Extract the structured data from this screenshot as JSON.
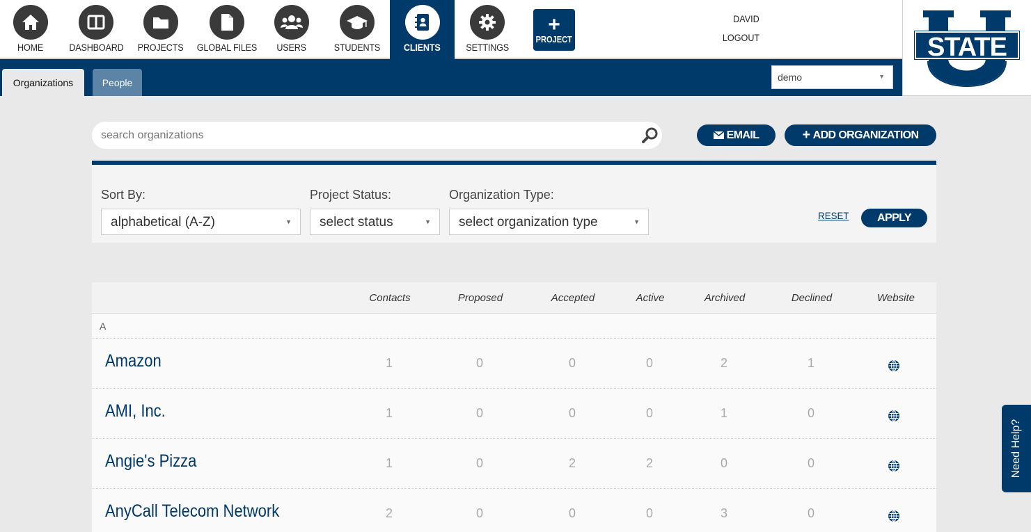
{
  "nav": {
    "items": [
      {
        "label": "HOME",
        "icon": "home-icon"
      },
      {
        "label": "DASHBOARD",
        "icon": "dashboard-icon"
      },
      {
        "label": "PROJECTS",
        "icon": "folder-icon"
      },
      {
        "label": "GLOBAL FILES",
        "icon": "file-icon"
      },
      {
        "label": "USERS",
        "icon": "users-icon"
      },
      {
        "label": "STUDENTS",
        "icon": "graduation-cap-icon"
      },
      {
        "label": "CLIENTS",
        "icon": "contact-book-icon",
        "active": true
      },
      {
        "label": "SETTINGS",
        "icon": "gear-icon"
      }
    ],
    "project_button": "PROJECT",
    "user_name": "DAVID",
    "logout": "LOGOUT"
  },
  "logo": {
    "text": "STATE"
  },
  "tabs": {
    "organizations": "Organizations",
    "people": "People",
    "site_select": "demo"
  },
  "search": {
    "placeholder": "search organizations"
  },
  "actions": {
    "email": "EMAIL",
    "add_organization": "ADD ORGANIZATION"
  },
  "filters": {
    "sort_label": "Sort By:",
    "sort_value": "alphabetical (A-Z)",
    "status_label": "Project Status:",
    "status_value": "select status",
    "type_label": "Organization Type:",
    "type_value": "select organization type",
    "reset": "RESET",
    "apply": "APPLY"
  },
  "table": {
    "columns": [
      "Contacts",
      "Proposed",
      "Accepted",
      "Active",
      "Archived",
      "Declined",
      "Website"
    ],
    "section_letter": "A",
    "rows": [
      {
        "name": "Amazon",
        "contacts": "1",
        "proposed": "0",
        "accepted": "0",
        "active": "0",
        "archived": "2",
        "declined": "1"
      },
      {
        "name": "AMI, Inc.",
        "contacts": "1",
        "proposed": "0",
        "accepted": "0",
        "active": "0",
        "archived": "1",
        "declined": "0"
      },
      {
        "name": "Angie's Pizza",
        "contacts": "1",
        "proposed": "0",
        "accepted": "2",
        "active": "2",
        "archived": "0",
        "declined": "0"
      },
      {
        "name": "AnyCall Telecom Network",
        "contacts": "2",
        "proposed": "0",
        "accepted": "0",
        "active": "0",
        "archived": "3",
        "declined": "0"
      }
    ]
  },
  "help": {
    "label": "Need Help?"
  },
  "colors": {
    "primary": "#003a6b",
    "tab_inactive": "#5b84a6",
    "page_bg": "#e9e9e9"
  }
}
